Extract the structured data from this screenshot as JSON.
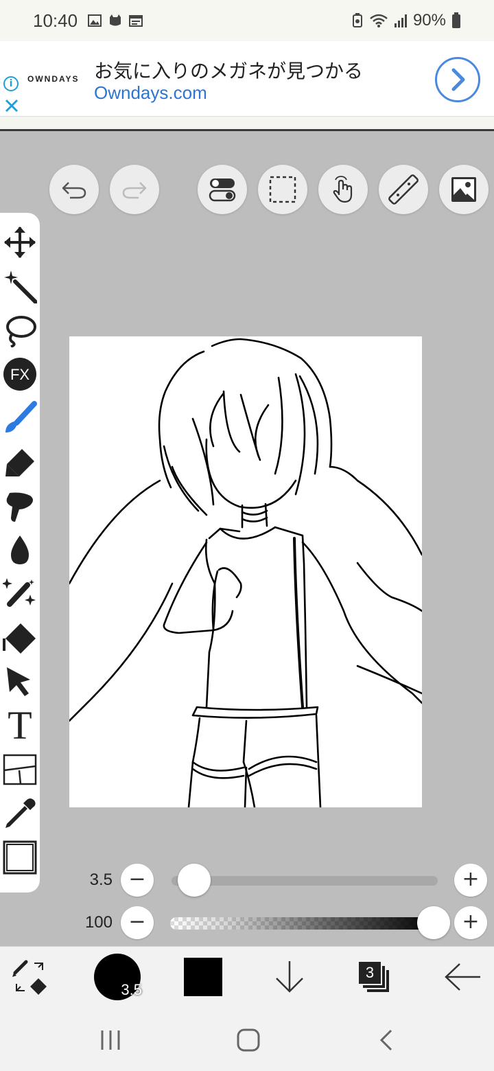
{
  "status_bar": {
    "time": "10:40",
    "battery": "90%"
  },
  "ad": {
    "brand": "OWNDAYS",
    "title": "お気に入りのメガネが見つかる",
    "site": "Owndays.com",
    "info_icon": "i",
    "accent": "#2b76d2"
  },
  "toolbar_top": {
    "items": [
      "undo-icon",
      "redo-icon",
      "toggle-icon",
      "selection-icon",
      "touch-icon",
      "ruler-icon",
      "image-icon"
    ]
  },
  "tools": [
    "move",
    "magic-wand",
    "lasso",
    "filter",
    "brush",
    "eraser",
    "smudge",
    "blur",
    "special-brush",
    "fill",
    "select-layer",
    "text",
    "frame-divider",
    "eyedropper",
    "canvas"
  ],
  "tools_fx_label": "FX",
  "tools_text_label": "T",
  "brush_size_slider": {
    "value_label": "3.5",
    "minus": "−",
    "plus": "+",
    "level": 0.02
  },
  "opacity_slider": {
    "value_label": "100",
    "minus": "−",
    "plus": "+",
    "level": 1.0
  },
  "bottom_bar": {
    "brush_size_label": "3.5",
    "current_color": "#000000",
    "layer_count": "3"
  }
}
